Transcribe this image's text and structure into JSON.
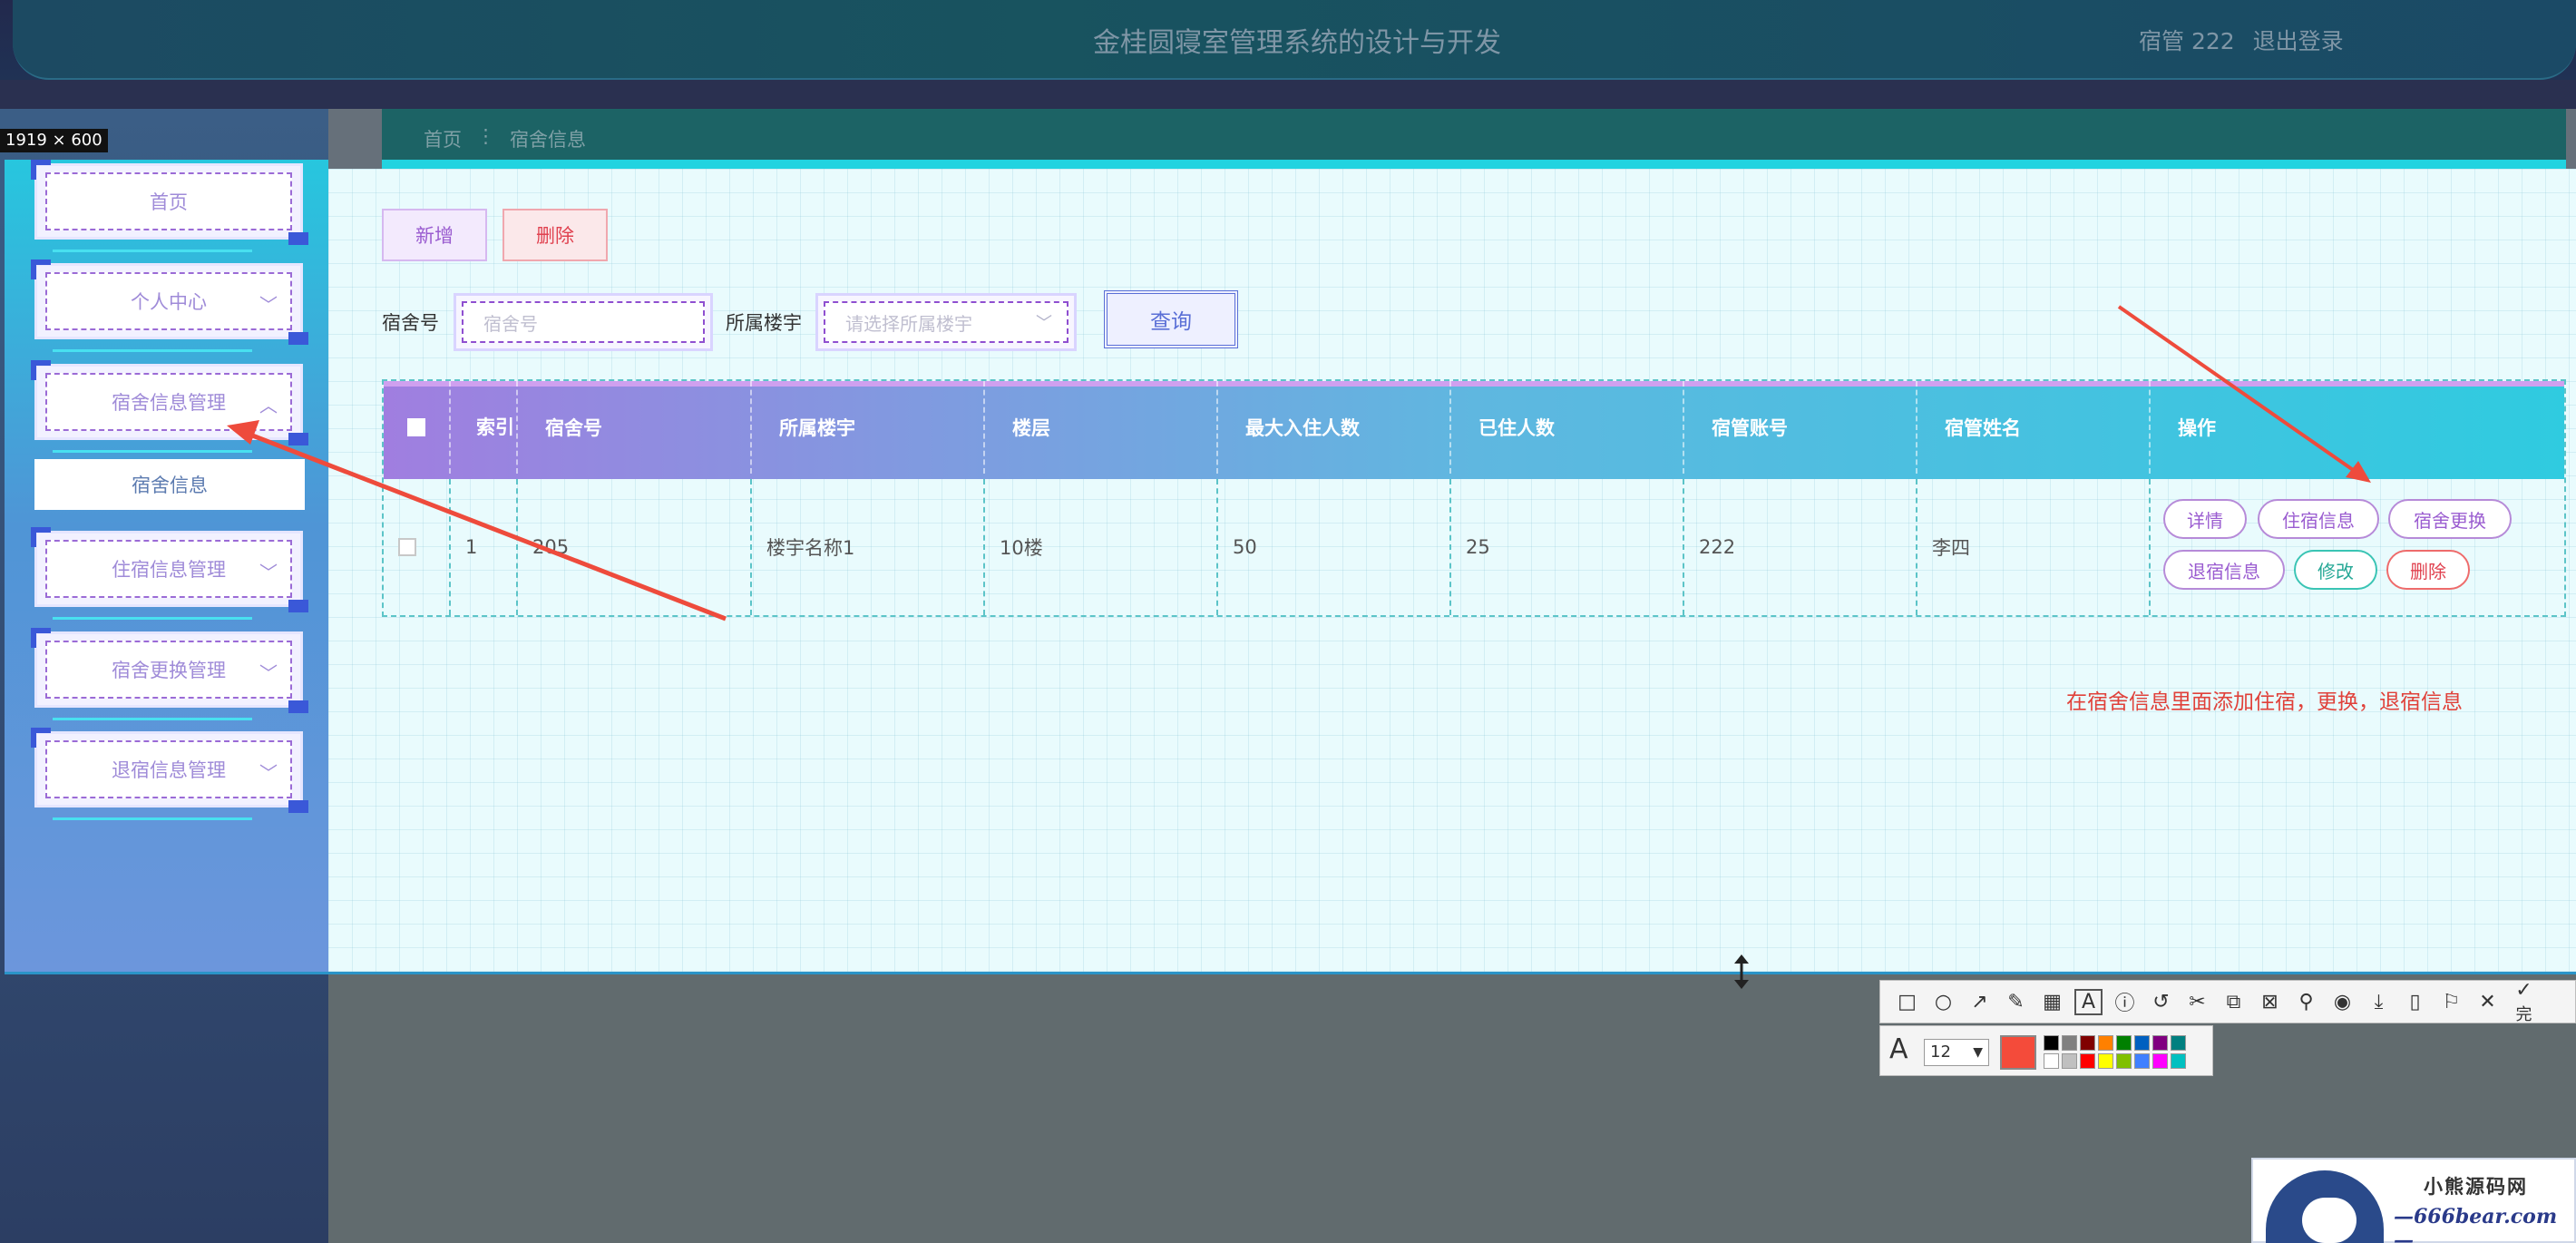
{
  "header": {
    "title": "金桂圆寝室管理系统的设计与开发",
    "user": "宿管 222",
    "logout": "退出登录"
  },
  "dimension_label": "1919 × 600",
  "sidebar": {
    "items": [
      {
        "label": "首页",
        "chevron": ""
      },
      {
        "label": "个人中心",
        "chevron": "﹀"
      },
      {
        "label": "宿舍信息管理",
        "chevron": "︿"
      },
      {
        "label": "住宿信息管理",
        "chevron": "﹀"
      },
      {
        "label": "宿舍更换管理",
        "chevron": "﹀"
      },
      {
        "label": "退宿信息管理",
        "chevron": "﹀"
      }
    ],
    "submenu": {
      "label": "宿舍信息"
    }
  },
  "breadcrumb": {
    "home": "首页",
    "separator": "⋮",
    "current": "宿舍信息"
  },
  "toolbar": {
    "add_label": "新增",
    "delete_label": "删除"
  },
  "search": {
    "dorm_label": "宿舍号",
    "dorm_placeholder": "宿舍号",
    "building_label": "所属楼宇",
    "building_placeholder": "请选择所属楼宇",
    "query_label": "查询"
  },
  "table": {
    "headers": [
      "",
      "索引",
      "宿舍号",
      "所属楼宇",
      "楼层",
      "最大入住人数",
      "已住人数",
      "宿管账号",
      "宿管姓名",
      "操作"
    ],
    "rows": [
      {
        "index": "1",
        "dorm": "205",
        "building": "楼宇名称1",
        "floor": "10楼",
        "max": "50",
        "current": "25",
        "account": "222",
        "name": "李四"
      }
    ],
    "actions": [
      "详情",
      "住宿信息",
      "宿舍更换",
      "退宿信息",
      "修改",
      "删除"
    ]
  },
  "annotation": "在宿舍信息里面添加住宿，更换，退宿信息",
  "snip_tools": {
    "font_size": "12",
    "current_color": "#f44b3a",
    "palette": [
      "#000000",
      "#808080",
      "#800000",
      "#ff8000",
      "#008000",
      "#0060c0",
      "#800080",
      "#008080",
      "#ffffff",
      "#c0c0c0",
      "#ff0000",
      "#ffff00",
      "#80c000",
      "#4080ff",
      "#ff00ff",
      "#00c0c0"
    ],
    "done_label": "完"
  },
  "watermark": {
    "line1": "小熊源码网",
    "line2": "—666bear.com—"
  }
}
